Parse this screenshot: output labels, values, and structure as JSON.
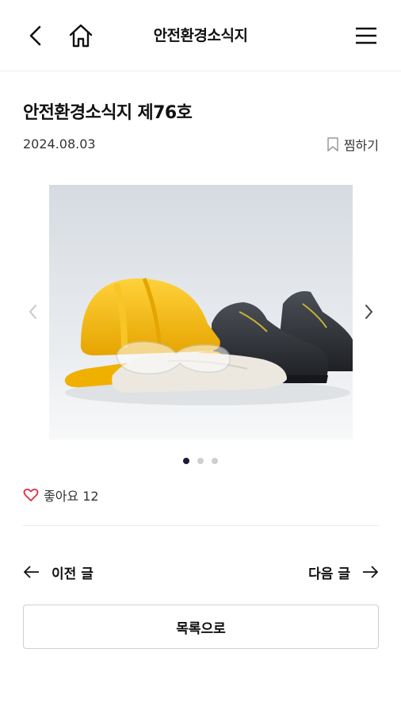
{
  "header": {
    "title": "안전환경소식지"
  },
  "post": {
    "title": "안전환경소식지 제76호",
    "date": "2024.08.03",
    "bookmark_label": "찜하기"
  },
  "carousel": {
    "total_slides": 3,
    "active_slide": 1
  },
  "likes": {
    "label": "좋아요 12"
  },
  "navigation": {
    "prev_label": "이전 글",
    "next_label": "다음 글"
  },
  "list_button": {
    "label": "목록으로"
  },
  "icons": {
    "back": "chevron-left-icon",
    "home": "home-icon",
    "menu": "hamburger-menu-icon",
    "bookmark": "bookmark-icon",
    "heart": "heart-icon",
    "arrow_left": "arrow-left-icon",
    "arrow_right": "arrow-right-icon"
  },
  "colors": {
    "heart": "#e0283a",
    "active_dot": "#1a1a3a",
    "inactive_dot": "#cfcfcf",
    "helmet": "#f5b800"
  }
}
